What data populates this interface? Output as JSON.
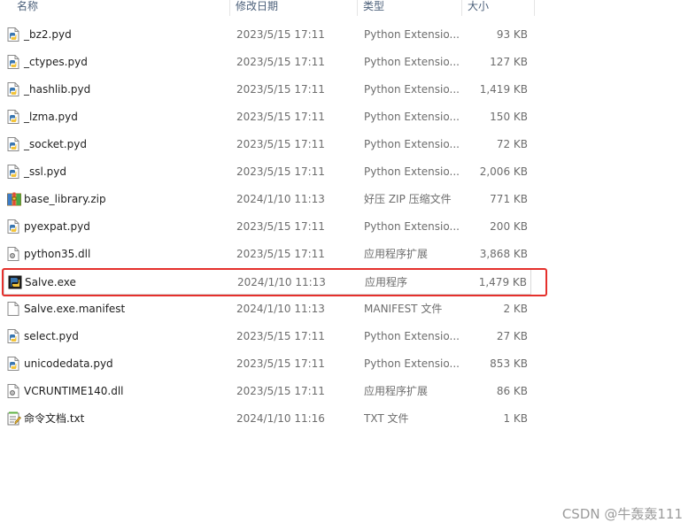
{
  "columns": {
    "name": "名称",
    "date": "修改日期",
    "type": "类型",
    "size": "大小"
  },
  "files": [
    {
      "name": "_bz2.pyd",
      "date": "2023/5/15 17:11",
      "type": "Python Extensio...",
      "size": "93 KB",
      "icon": "python-file-icon"
    },
    {
      "name": "_ctypes.pyd",
      "date": "2023/5/15 17:11",
      "type": "Python Extensio...",
      "size": "127 KB",
      "icon": "python-file-icon"
    },
    {
      "name": "_hashlib.pyd",
      "date": "2023/5/15 17:11",
      "type": "Python Extensio...",
      "size": "1,419 KB",
      "icon": "python-file-icon"
    },
    {
      "name": "_lzma.pyd",
      "date": "2023/5/15 17:11",
      "type": "Python Extensio...",
      "size": "150 KB",
      "icon": "python-file-icon"
    },
    {
      "name": "_socket.pyd",
      "date": "2023/5/15 17:11",
      "type": "Python Extensio...",
      "size": "72 KB",
      "icon": "python-file-icon"
    },
    {
      "name": "_ssl.pyd",
      "date": "2023/5/15 17:11",
      "type": "Python Extensio...",
      "size": "2,006 KB",
      "icon": "python-file-icon"
    },
    {
      "name": "base_library.zip",
      "date": "2024/1/10 11:13",
      "type": "好压 ZIP 压缩文件",
      "size": "771 KB",
      "icon": "zip-archive-icon"
    },
    {
      "name": "pyexpat.pyd",
      "date": "2023/5/15 17:11",
      "type": "Python Extensio...",
      "size": "200 KB",
      "icon": "python-file-icon"
    },
    {
      "name": "python35.dll",
      "date": "2023/5/15 17:11",
      "type": "应用程序扩展",
      "size": "3,868 KB",
      "icon": "dll-file-icon"
    },
    {
      "name": "Salve.exe",
      "date": "2024/1/10 11:13",
      "type": "应用程序",
      "size": "1,479 KB",
      "icon": "python-exe-icon"
    },
    {
      "name": "Salve.exe.manifest",
      "date": "2024/1/10 11:13",
      "type": "MANIFEST 文件",
      "size": "2 KB",
      "icon": "blank-file-icon"
    },
    {
      "name": "select.pyd",
      "date": "2023/5/15 17:11",
      "type": "Python Extensio...",
      "size": "27 KB",
      "icon": "python-file-icon"
    },
    {
      "name": "unicodedata.pyd",
      "date": "2023/5/15 17:11",
      "type": "Python Extensio...",
      "size": "853 KB",
      "icon": "python-file-icon"
    },
    {
      "name": "VCRUNTIME140.dll",
      "date": "2023/5/15 17:11",
      "type": "应用程序扩展",
      "size": "86 KB",
      "icon": "dll-file-icon"
    },
    {
      "name": "命令文档.txt",
      "date": "2024/1/10 11:16",
      "type": "TXT 文件",
      "size": "1 KB",
      "icon": "text-file-icon"
    }
  ],
  "watermark": "CSDN @牛轰轰111",
  "colors": {
    "highlight": "#e5302c",
    "header_text": "#4c607a",
    "secondary_text": "#6d6d6d"
  }
}
